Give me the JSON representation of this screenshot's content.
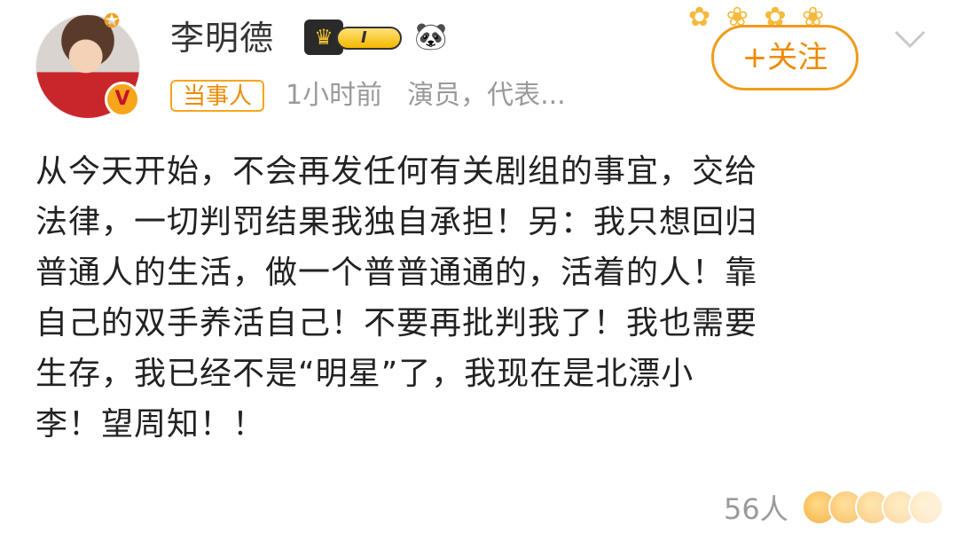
{
  "post": {
    "author": {
      "name": "李明德",
      "level_label": "I",
      "tag": "当事人",
      "time": "1小时前",
      "description": "演员，代表..."
    },
    "follow_label": "+关注",
    "content": "从今天开始，不会再发任何有关剧组的事宜，交给\n法律，一切判罚结果我独自承担！另：我只想回归\n普通人的生活，做一个普普通通的，活着的人！靠\n自己的双手养活自己！不要再批判我了！我也需要\n生存，我已经不是“明星”了，我现在是北漂小\n李！望周知！！",
    "likes_text": "56人"
  },
  "icons": {
    "avatar_badge": "camera-badge-icon",
    "verify_badge": "verified-v-icon",
    "crown": "crown-icon",
    "panda": "panda-icon",
    "chevron": "chevron-down-icon",
    "decoration": "flower-sticker-icon"
  },
  "colors": {
    "accent": "#f08a00",
    "tag_border": "#f7a51b",
    "text": "#222222",
    "meta": "#9a9a9a"
  }
}
